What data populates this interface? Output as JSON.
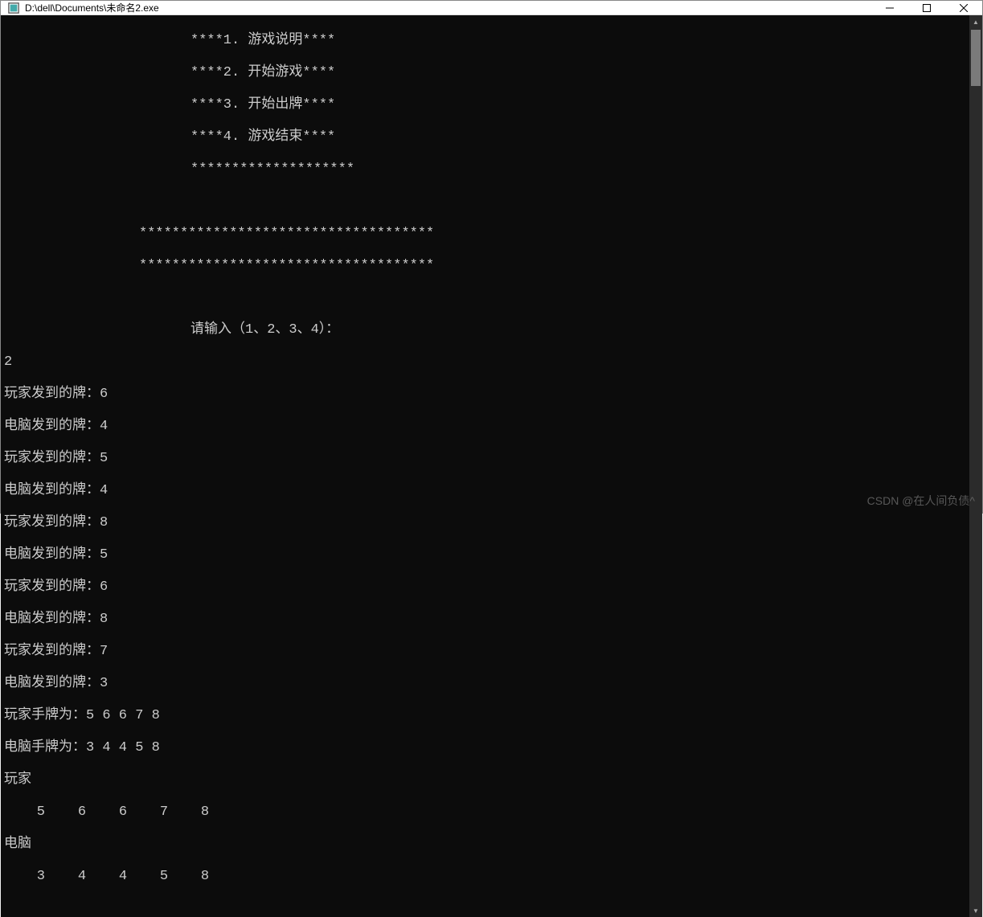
{
  "window": {
    "title": "D:\\dell\\Documents\\未命名2.exe"
  },
  "menu": {
    "item1": "****1. 游戏说明****",
    "item2": "****2. 开始游戏****",
    "item3": "****3. 开始出牌****",
    "item4": "****4. 游戏结束****",
    "divider_short": "********************",
    "divider_long1": "************************************",
    "divider_long2": "************************************",
    "prompt": "请输入（1、2、3、4）："
  },
  "input": {
    "choice": "2"
  },
  "deals": {
    "l1": "玩家发到的牌：6",
    "l2": "电脑发到的牌：4",
    "l3": "玩家发到的牌：5",
    "l4": "电脑发到的牌：4",
    "l5": "玩家发到的牌：8",
    "l6": "电脑发到的牌：5",
    "l7": "玩家发到的牌：6",
    "l8": "电脑发到的牌：8",
    "l9": "玩家发到的牌：7",
    "l10": "电脑发到的牌：3"
  },
  "hands": {
    "player_label": "玩家手牌为：5 6 6 7 8",
    "cpu_label": "电脑手牌为：3 4 4 5 8",
    "player_header": "玩家",
    "player_row": "    5    6    6    7    8",
    "cpu_header": "电脑",
    "cpu_row": "    3    4    4    5    8"
  },
  "watermark": "CSDN @在人间负债^"
}
